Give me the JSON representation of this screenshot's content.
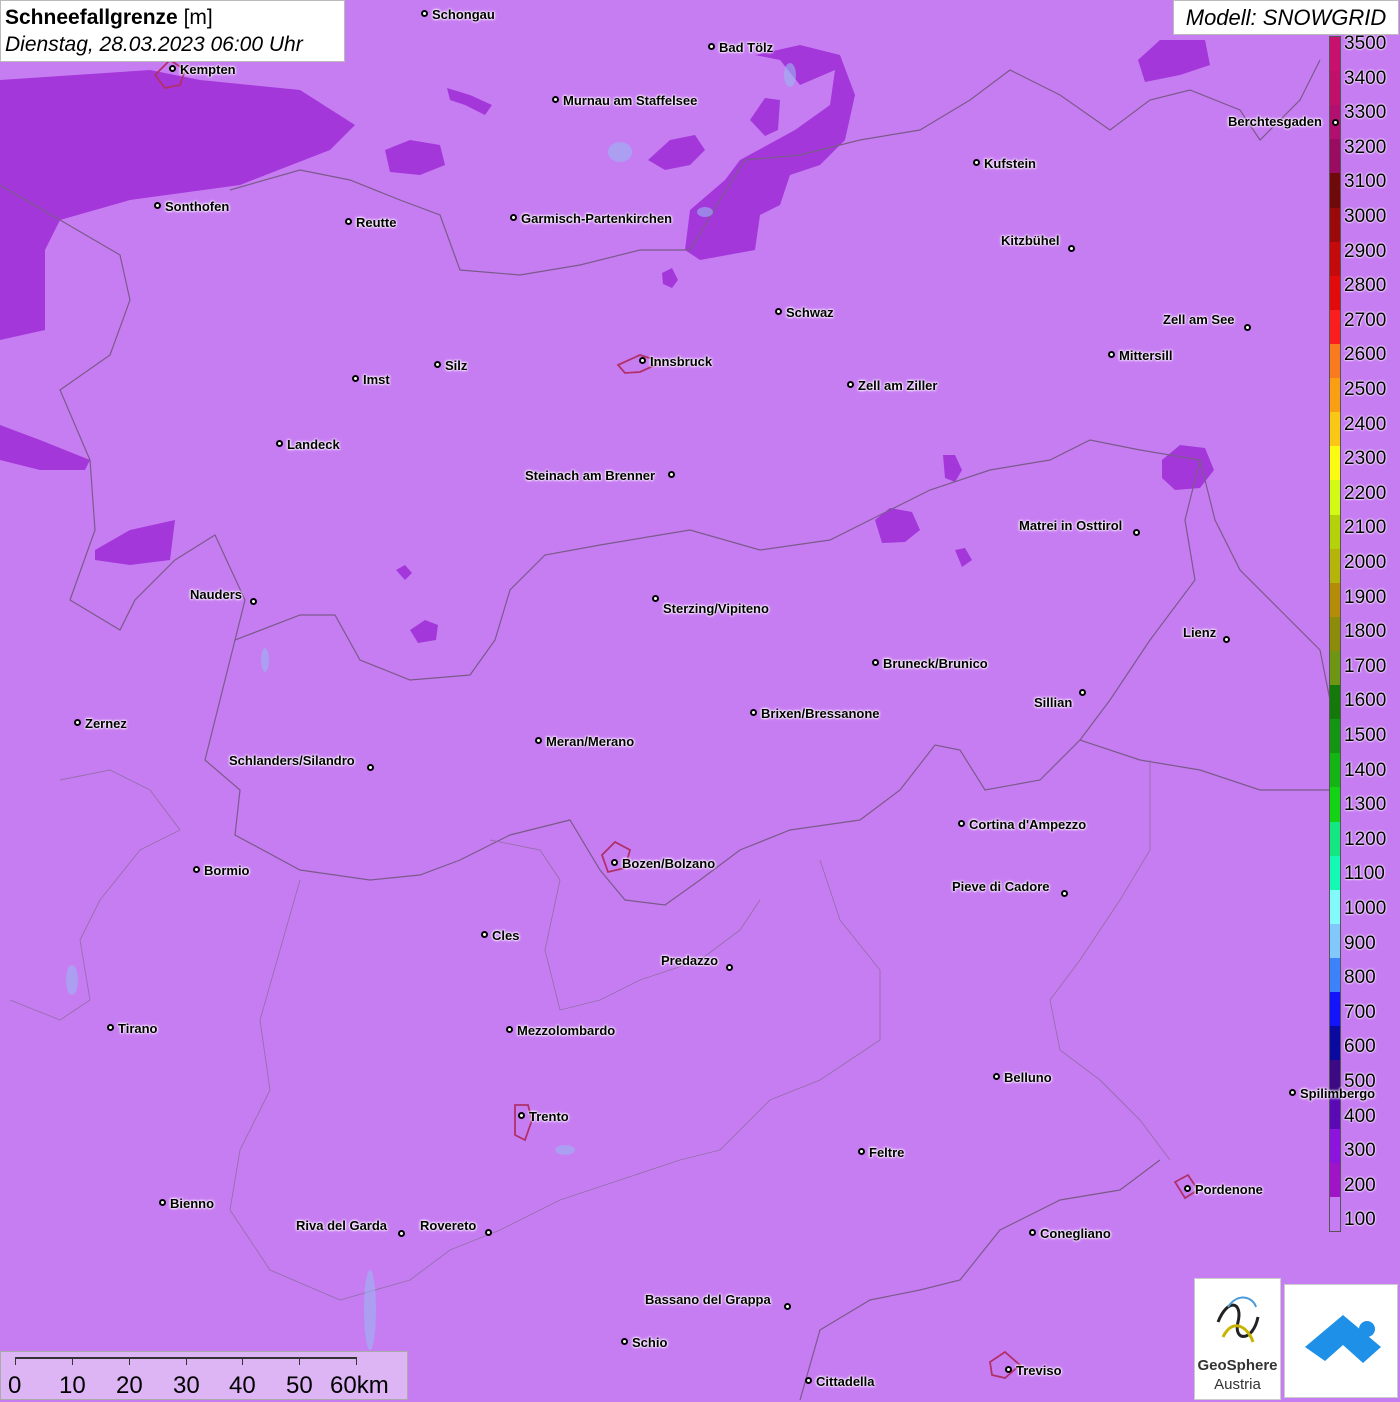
{
  "header": {
    "title_bold": "Schneefallgrenze",
    "title_unit": " [m]",
    "date": "Dienstag, 28.03.2023 06:00 Uhr",
    "model": "Modell: SNOWGRID"
  },
  "legend": {
    "labels": [
      "3500",
      "3400",
      "3300",
      "3200",
      "3100",
      "3000",
      "2900",
      "2800",
      "2700",
      "2600",
      "2500",
      "2400",
      "2300",
      "2200",
      "2100",
      "2000",
      "1900",
      "1800",
      "1700",
      "1600",
      "1500",
      "1400",
      "1300",
      "1200",
      "1100",
      "1000",
      "900",
      "800",
      "700",
      "600",
      "500",
      "400",
      "300",
      "200",
      "100"
    ],
    "colors": [
      "#c8106e",
      "#c0106a",
      "#b21070",
      "#9a0c62",
      "#6e0a0a",
      "#9a0a0a",
      "#c40a0a",
      "#e20a0a",
      "#fa1e1e",
      "#fa7a1e",
      "#fa9e14",
      "#fac814",
      "#fafa14",
      "#d2fa14",
      "#b4d20a",
      "#b4b40a",
      "#b48c0a",
      "#8c8c0a",
      "#6e9614",
      "#14780a",
      "#149614",
      "#14b414",
      "#14d214",
      "#14e682",
      "#14fab4",
      "#82fafa",
      "#82c8fa",
      "#3c82fa",
      "#1414fa",
      "#0a0aa0",
      "#3c0a82",
      "#5a0ab4",
      "#8c14dc",
      "#a014c8",
      "#c77df2"
    ]
  },
  "cities": [
    {
      "name": "Schongau"
    },
    {
      "name": "Bad Tölz"
    },
    {
      "name": "Kempten"
    },
    {
      "name": "Murnau am Staffelsee"
    },
    {
      "name": "Berchtesgaden"
    },
    {
      "name": "Kufstein"
    },
    {
      "name": "Sonthofen"
    },
    {
      "name": "Reutte"
    },
    {
      "name": "Garmisch-Partenkirchen"
    },
    {
      "name": "Kitzbühel"
    },
    {
      "name": "Schwaz"
    },
    {
      "name": "Zell am See"
    },
    {
      "name": "Mittersill"
    },
    {
      "name": "Innsbruck"
    },
    {
      "name": "Silz"
    },
    {
      "name": "Imst"
    },
    {
      "name": "Zell am Ziller"
    },
    {
      "name": "Landeck"
    },
    {
      "name": "Steinach am Brenner"
    },
    {
      "name": "Matrei in Osttirol"
    },
    {
      "name": "Nauders"
    },
    {
      "name": "Sterzing/Vipiteno"
    },
    {
      "name": "Lienz"
    },
    {
      "name": "Bruneck/Brunico"
    },
    {
      "name": "Sillian"
    },
    {
      "name": "Brixen/Bressanone"
    },
    {
      "name": "Zernez"
    },
    {
      "name": "Meran/Merano"
    },
    {
      "name": "Schlanders/Silandro"
    },
    {
      "name": "Cortina d'Ampezzo"
    },
    {
      "name": "Bozen/Bolzano"
    },
    {
      "name": "Bormio"
    },
    {
      "name": "Pieve di Cadore"
    },
    {
      "name": "Cles"
    },
    {
      "name": "Predazzo"
    },
    {
      "name": "Tirano"
    },
    {
      "name": "Mezzolombardo"
    },
    {
      "name": "Belluno"
    },
    {
      "name": "Spilimbergo"
    },
    {
      "name": "Trento"
    },
    {
      "name": "Feltre"
    },
    {
      "name": "Pordenone"
    },
    {
      "name": "Bienno"
    },
    {
      "name": "Riva del Garda"
    },
    {
      "name": "Rovereto"
    },
    {
      "name": "Conegliano"
    },
    {
      "name": "Bassano del Grappa"
    },
    {
      "name": "Schio"
    },
    {
      "name": "Treviso"
    },
    {
      "name": "Cittadella"
    }
  ],
  "scale": {
    "labels": [
      "0",
      "10",
      "20",
      "30",
      "40",
      "50",
      "60km"
    ]
  },
  "logos": {
    "geosphere_line1": "GeoSphere",
    "geosphere_line2": "Austria"
  },
  "colors": {
    "base": "#c77df2",
    "snow_200": "#a030d8",
    "border": "#7a5a8a"
  }
}
